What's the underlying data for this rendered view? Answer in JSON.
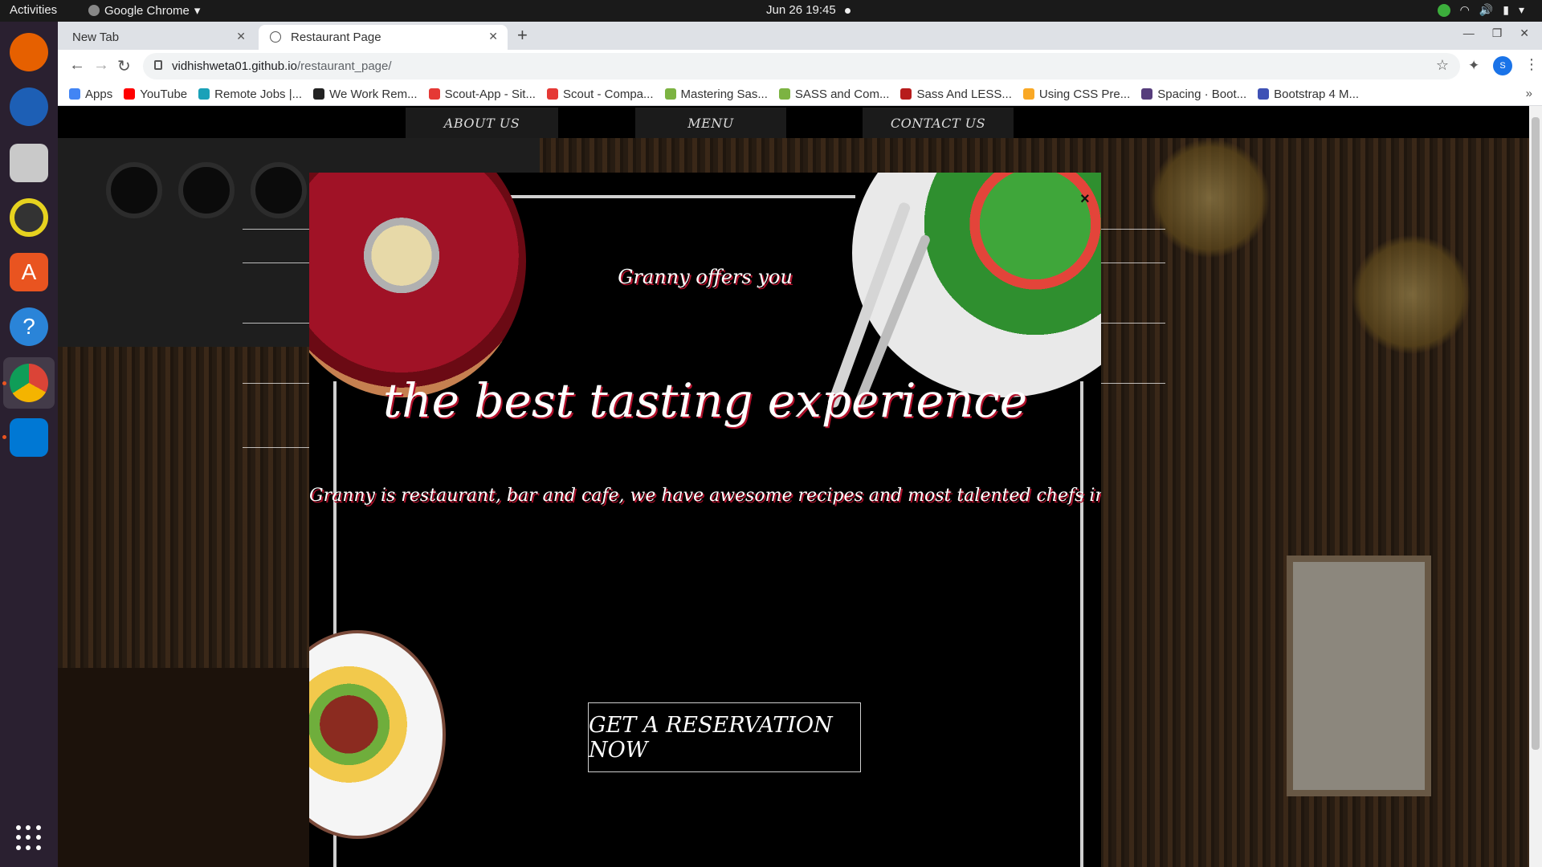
{
  "os": {
    "activities": "Activities",
    "app_menu": "Google Chrome",
    "clock": "Jun 26  19:45"
  },
  "browser": {
    "tabs": [
      {
        "label": "New Tab"
      },
      {
        "label": "Restaurant Page"
      }
    ],
    "url_host": "vidhishweta01.github.io",
    "url_path": "/restaurant_page/",
    "profile_initial": "S",
    "bookmarks": [
      {
        "label": "Apps",
        "color": "#4285f4"
      },
      {
        "label": "YouTube",
        "color": "#ff0000"
      },
      {
        "label": "Remote Jobs |...",
        "color": "#1aa1b8"
      },
      {
        "label": "We Work Rem...",
        "color": "#222222"
      },
      {
        "label": "Scout-App - Sit...",
        "color": "#e53935"
      },
      {
        "label": "Scout - Compa...",
        "color": "#e53935"
      },
      {
        "label": "Mastering Sas...",
        "color": "#7cb342"
      },
      {
        "label": "SASS and Com...",
        "color": "#7cb342"
      },
      {
        "label": "Sass And LESS...",
        "color": "#b71c1c"
      },
      {
        "label": "Using CSS Pre...",
        "color": "#f9a825"
      },
      {
        "label": "Spacing · Boot...",
        "color": "#563d7c"
      },
      {
        "label": "Bootstrap 4 M...",
        "color": "#3f51b5"
      }
    ],
    "bookmarks_more": "»"
  },
  "site": {
    "nav": [
      {
        "label": "ABOUT US"
      },
      {
        "label": "MENU"
      },
      {
        "label": "CONTACT US"
      }
    ]
  },
  "modal": {
    "close": "×",
    "offer": "Granny offers you",
    "headline": "the best tasting experience",
    "description": "Granny is restaurant, bar and cafe, we have awesome recipes and most talented chefs in town",
    "cta": "GET A RESERVATION NOW"
  }
}
